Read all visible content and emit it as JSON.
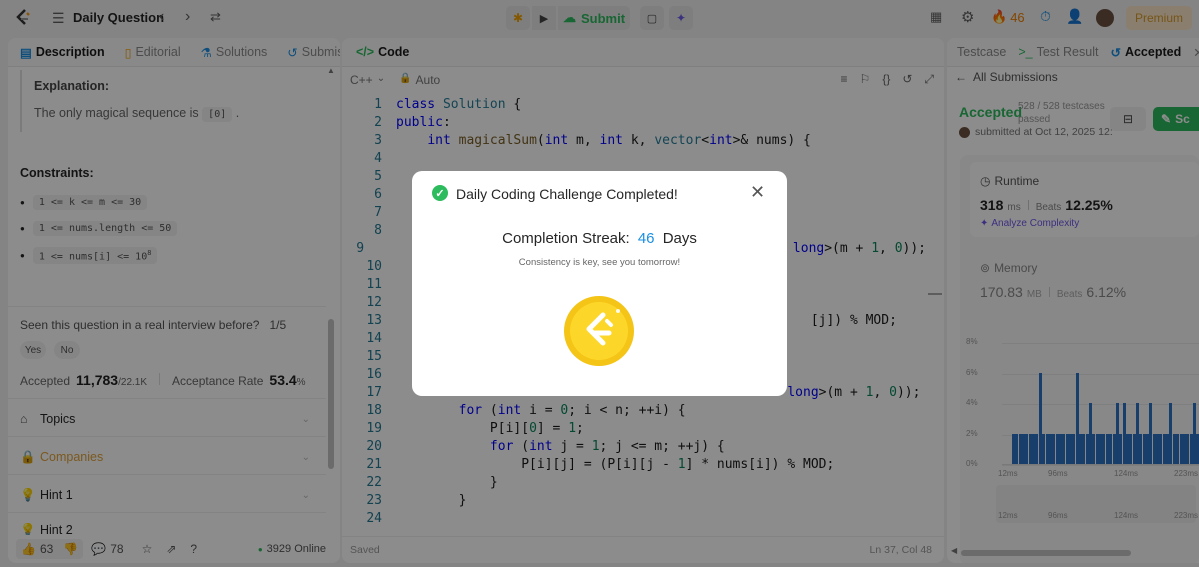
{
  "topbar": {
    "title": "Daily Question",
    "submit": "Submit",
    "streak": "46",
    "premium": "Premium"
  },
  "left": {
    "tabs": [
      "Description",
      "Editorial",
      "Solutions",
      "Submissions"
    ],
    "explanation_label": "Explanation:",
    "explanation_text": "The only magical sequence is",
    "explanation_code": "[0]",
    "explanation_end": ".",
    "constraints_label": "Constraints:",
    "constraints": [
      "1 <= k <= m <= 30",
      "1 <= nums.length <= 50",
      "1 <= nums[i] <= 10"
    ],
    "constraint_sup": "8",
    "interview_q": "Seen this question in a real interview before?",
    "interview_count": "1/5",
    "yes": "Yes",
    "no": "No",
    "accepted_label": "Accepted",
    "accepted_value": "11,783",
    "accepted_total": "/22.1K",
    "rate_label": "Acceptance Rate",
    "rate_value": "53.4",
    "rate_unit": "%",
    "sections": [
      "Topics",
      "Companies",
      "Hint 1",
      "Hint 2"
    ],
    "likes": "63",
    "comments": "78",
    "online": "3929 Online"
  },
  "editor": {
    "tab": "Code",
    "lang": "C++",
    "mode": "Auto",
    "saved": "Saved",
    "cursor": "Ln 37, Col 48",
    "lines": [
      {
        "n": "1",
        "h": "<span class='kw'>class</span> <span class='ty'>Solution</span> {"
      },
      {
        "n": "2",
        "h": "<span class='kw'>public</span>:"
      },
      {
        "n": "3",
        "h": "    <span class='kw'>int</span> <span class='fn'>magicalSum</span>(<span class='kw'>int</span> m, <span class='kw'>int</span> k, <span class='ty'>vector</span>&lt;<span class='kw'>int</span>&gt;&amp; nums) {"
      },
      {
        "n": "4",
        "h": ""
      },
      {
        "n": "5",
        "h": ""
      },
      {
        "n": "6",
        "h": ""
      },
      {
        "n": "7",
        "h": ""
      },
      {
        "n": "8",
        "h": ""
      },
      {
        "n": "9",
        "h": "                                                     <span class='kw'>long</span>&gt;(m + <span class='nm'>1</span>, <span class='nm'>0</span>));"
      },
      {
        "n": "10",
        "h": ""
      },
      {
        "n": "11",
        "h": ""
      },
      {
        "n": "12",
        "h": ""
      },
      {
        "n": "13",
        "h": "                                                     [j]) % MOD;"
      },
      {
        "n": "14",
        "h": ""
      },
      {
        "n": "15",
        "h": ""
      },
      {
        "n": "16",
        "h": ""
      },
      {
        "n": "17",
        "h": "                                                  <span class='kw'>long</span>&gt;(m + <span class='nm'>1</span>, <span class='nm'>0</span>));"
      },
      {
        "n": "18",
        "h": "        <span class='kw'>for</span> (<span class='kw'>int</span> i = <span class='nm'>0</span>; i &lt; n; ++i) {"
      },
      {
        "n": "19",
        "h": "            P[i][<span class='nm'>0</span>] = <span class='nm'>1</span>;"
      },
      {
        "n": "20",
        "h": "            <span class='kw'>for</span> (<span class='kw'>int</span> j = <span class='nm'>1</span>; j &lt;= m; ++j) {"
      },
      {
        "n": "21",
        "h": "                P[i][j] = (P[i][j - <span class='nm'>1</span>] * nums[i]) % MOD;"
      },
      {
        "n": "22",
        "h": "            }"
      },
      {
        "n": "23",
        "h": "        }"
      },
      {
        "n": "24",
        "h": ""
      }
    ]
  },
  "right": {
    "tabs": [
      "Testcase",
      "Test Result",
      "Accepted"
    ],
    "back": "All Submissions",
    "status": "Accepted",
    "testcases": "528 / 528 testcases",
    "passed": "passed",
    "submitted": "submitted at Oct 12, 2025 12:",
    "submit_btn": "Sc",
    "runtime_label": "Runtime",
    "runtime_val": "318",
    "runtime_unit": "ms",
    "beats": "Beats",
    "runtime_beats": "12.25%",
    "analyze": "Analyze Complexity",
    "memory_label": "Memory",
    "memory_val": "170.83",
    "memory_unit": "MB",
    "memory_beats": "6.12%",
    "yticks": [
      "8%",
      "6%",
      "4%",
      "2%",
      "0%"
    ],
    "xticks": [
      "12ms",
      "96ms",
      "124ms",
      "223ms"
    ]
  },
  "chart_data": {
    "type": "bar",
    "title": "",
    "xlabel": "",
    "ylabel": "",
    "ylim": [
      0,
      8
    ],
    "yticks": [
      "8%",
      "6%",
      "4%",
      "2%",
      "0%"
    ],
    "xticks": [
      "12ms",
      "96ms",
      "124ms",
      "223ms"
    ],
    "values": [
      2,
      2,
      2,
      2,
      2,
      2,
      2,
      2,
      6,
      2,
      2,
      2,
      2,
      2,
      2,
      2,
      2,
      2,
      2,
      6,
      2,
      2,
      2,
      4,
      2,
      2,
      2,
      2,
      2,
      2,
      2,
      4,
      2,
      4,
      2,
      2,
      2,
      4,
      2,
      2,
      2,
      4,
      2,
      2,
      2,
      2,
      2,
      4,
      2,
      2,
      2,
      2,
      2,
      2,
      4,
      2,
      2
    ]
  },
  "modal": {
    "title": "Daily Coding Challenge Completed!",
    "streak_label": "Completion Streak:",
    "streak_value": "46",
    "streak_unit": "Days",
    "subtitle": "Consistency is key, see you tomorrow!"
  }
}
